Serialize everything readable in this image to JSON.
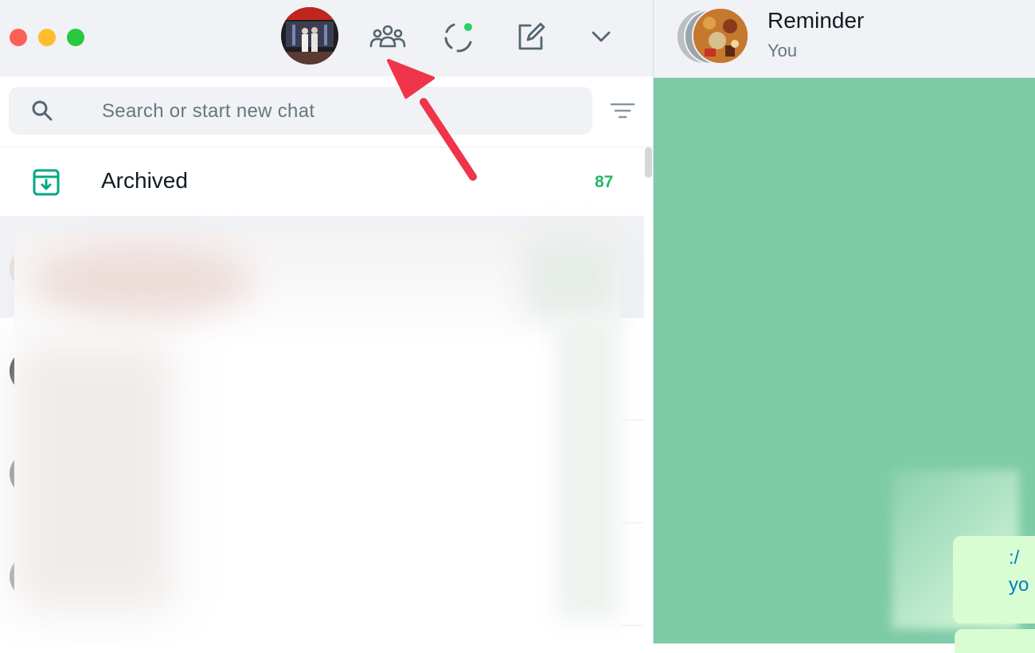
{
  "window": {
    "traffic_lights": [
      "close",
      "minimize",
      "zoom"
    ]
  },
  "toolbar": {
    "icons": [
      "profile-avatar",
      "communities-icon",
      "status-icon",
      "new-chat-icon",
      "menu-chevron-icon"
    ],
    "status_dot_color": "#25d366"
  },
  "search": {
    "placeholder": "Search or start new chat",
    "value": ""
  },
  "archived": {
    "label": "Archived",
    "count": "87"
  },
  "chat": {
    "title": "Reminder",
    "subtitle": "You",
    "link_fragments": [
      ":/",
      "yo"
    ]
  },
  "colors": {
    "accent": "#25b866",
    "chat_bg": "#7ecba8",
    "annotation_arrow": "#f0344a"
  }
}
